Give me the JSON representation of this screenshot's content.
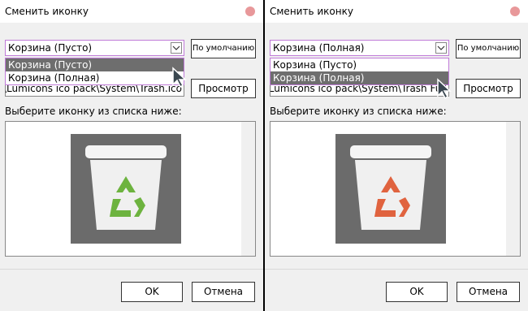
{
  "panels": [
    {
      "title": "Сменить иконку",
      "combo_value": "Корзина (Пусто)",
      "options": [
        "Корзина (Пусто)",
        "Корзина (Полная)"
      ],
      "selected_option": "Корзина (Пусто)",
      "default_button": "По умолчанию",
      "path_value": "\\Lumicons ico pack\\System\\Trash.ico",
      "browse_button": "Просмотр",
      "list_label": "Выберите иконку из списка ниже:",
      "icon": "trash-empty-icon",
      "recycle_color": "#6db33f",
      "ok_button": "OK",
      "cancel_button": "Отмена"
    },
    {
      "title": "Сменить иконку",
      "combo_value": "Корзина (Полная)",
      "options": [
        "Корзина (Пусто)",
        "Корзина (Полная)"
      ],
      "selected_option": "Корзина (Полная)",
      "default_button": "По умолчанию",
      "path_value": "\\Lumicons ico pack\\System\\Trash Full",
      "browse_button": "Просмотр",
      "list_label": "Выберите иконку из списка ниже:",
      "icon": "trash-full-icon",
      "recycle_color": "#e0633f",
      "ok_button": "OK",
      "cancel_button": "Отмена"
    }
  ]
}
